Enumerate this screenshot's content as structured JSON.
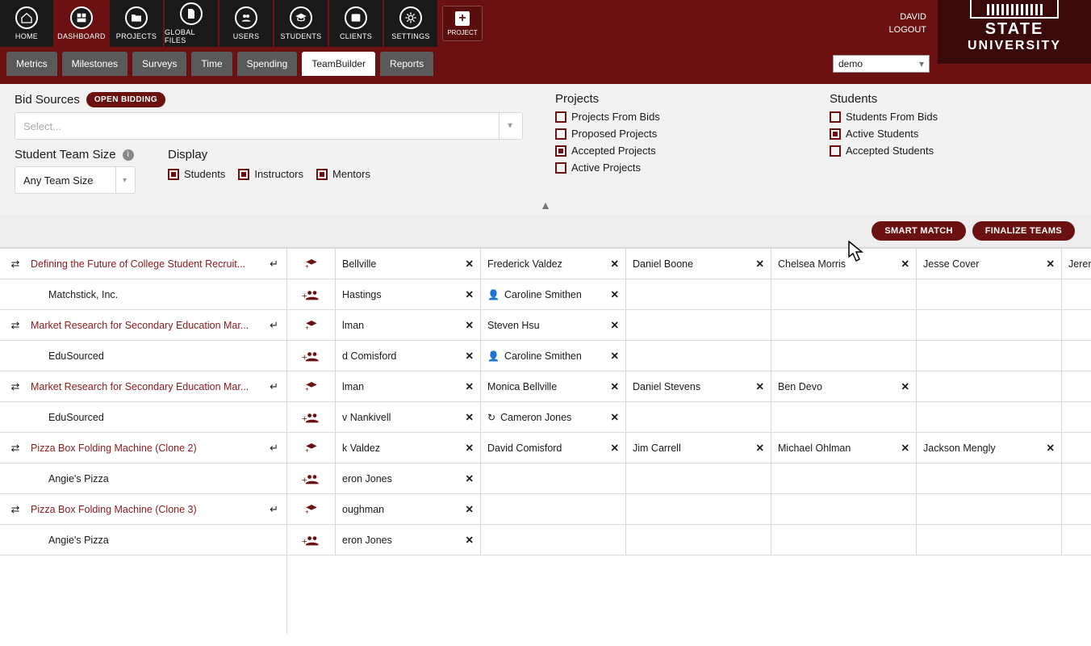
{
  "nav": [
    {
      "label": "HOME",
      "icon": "home",
      "active": false
    },
    {
      "label": "DASHBOARD",
      "icon": "dashboard",
      "active": true
    },
    {
      "label": "PROJECTS",
      "icon": "folder",
      "active": false
    },
    {
      "label": "GLOBAL FILES",
      "icon": "file",
      "active": false
    },
    {
      "label": "USERS",
      "icon": "users",
      "active": false
    },
    {
      "label": "STUDENTS",
      "icon": "grad",
      "active": false
    },
    {
      "label": "CLIENTS",
      "icon": "id",
      "active": false
    },
    {
      "label": "SETTINGS",
      "icon": "cog",
      "active": false
    }
  ],
  "projectBtn": {
    "plus": "+",
    "label": "PROJECT"
  },
  "user": {
    "name": "DAVID",
    "action": "LOGOUT"
  },
  "logo": {
    "line1": "STATE",
    "line2": "UNIVERSITY"
  },
  "tabs": [
    "Metrics",
    "Milestones",
    "Surveys",
    "Time",
    "Spending",
    "TeamBuilder",
    "Reports"
  ],
  "activeTab": "TeamBuilder",
  "orgSelect": "demo",
  "bidSources": {
    "title": "Bid Sources",
    "pill": "OPEN BIDDING",
    "placeholder": "Select..."
  },
  "teamSize": {
    "title": "Student Team Size",
    "value": "Any Team Size"
  },
  "display": {
    "title": "Display",
    "students": "Students",
    "instructors": "Instructors",
    "mentors": "Mentors"
  },
  "projects": {
    "title": "Projects",
    "fromBids": "Projects From Bids",
    "proposed": "Proposed Projects",
    "accepted": "Accepted Projects",
    "active": "Active Projects"
  },
  "students": {
    "title": "Students",
    "fromBids": "Students From Bids",
    "active": "Active Students",
    "accepted": "Accepted Students"
  },
  "actions": {
    "smart": "SMART MATCH",
    "finalize": "FINALIZE TEAMS"
  },
  "rows": [
    {
      "type": "proj",
      "name": "Defining the Future of College Student Recruit...",
      "arrow": true,
      "students": [
        {
          "n": "Bellville"
        },
        {
          "n": "Frederick Valdez"
        },
        {
          "n": "Daniel Boone"
        },
        {
          "n": "Chelsea Morris"
        },
        {
          "n": "Jesse Cover"
        },
        {
          "n": "Jeremey E"
        }
      ],
      "add": "grad"
    },
    {
      "type": "comp",
      "name": "Matchstick, Inc.",
      "students": [
        {
          "n": "Hastings"
        },
        {
          "n": "Caroline Smithen",
          "i": true
        },
        {
          "n": ""
        },
        {
          "n": ""
        },
        {
          "n": ""
        },
        {
          "n": ""
        }
      ],
      "add": "team"
    },
    {
      "type": "proj",
      "name": "Market Research for Secondary Education Mar...",
      "arrow": true,
      "students": [
        {
          "n": "lman"
        },
        {
          "n": "Steven Hsu"
        },
        {
          "n": ""
        },
        {
          "n": ""
        },
        {
          "n": ""
        },
        {
          "n": ""
        }
      ],
      "add": "grad"
    },
    {
      "type": "comp",
      "name": "EduSourced",
      "students": [
        {
          "n": "d Comisford"
        },
        {
          "n": "Caroline Smithen",
          "i": true
        },
        {
          "n": ""
        },
        {
          "n": ""
        },
        {
          "n": ""
        },
        {
          "n": ""
        }
      ],
      "add": "team"
    },
    {
      "type": "proj",
      "name": "Market Research for Secondary Education Mar...",
      "arrow": true,
      "students": [
        {
          "n": "lman"
        },
        {
          "n": "Monica Bellville"
        },
        {
          "n": "Daniel Stevens"
        },
        {
          "n": "Ben Devo"
        },
        {
          "n": ""
        },
        {
          "n": ""
        }
      ],
      "add": "grad"
    },
    {
      "type": "comp",
      "name": "EduSourced",
      "students": [
        {
          "n": "v Nankivell"
        },
        {
          "n": "Cameron Jones",
          "i2": true
        },
        {
          "n": ""
        },
        {
          "n": ""
        },
        {
          "n": ""
        },
        {
          "n": ""
        }
      ],
      "add": "team"
    },
    {
      "type": "proj",
      "name": "Pizza Box Folding Machine (Clone 2)",
      "arrow": true,
      "students": [
        {
          "n": "k Valdez"
        },
        {
          "n": "David Comisford"
        },
        {
          "n": "Jim Carrell"
        },
        {
          "n": "Michael Ohlman"
        },
        {
          "n": "Jackson Mengly"
        },
        {
          "n": ""
        }
      ],
      "add": "grad"
    },
    {
      "type": "comp",
      "name": "Angie's Pizza",
      "students": [
        {
          "n": "eron Jones"
        },
        {
          "n": ""
        },
        {
          "n": ""
        },
        {
          "n": ""
        },
        {
          "n": ""
        },
        {
          "n": ""
        }
      ],
      "add": "team"
    },
    {
      "type": "proj",
      "name": "Pizza Box Folding Machine (Clone 3)",
      "arrow": true,
      "students": [
        {
          "n": "oughman"
        },
        {
          "n": ""
        },
        {
          "n": ""
        },
        {
          "n": ""
        },
        {
          "n": ""
        },
        {
          "n": ""
        }
      ],
      "add": "grad"
    },
    {
      "type": "comp",
      "name": "Angie's Pizza",
      "students": [
        {
          "n": "eron Jones"
        },
        {
          "n": ""
        },
        {
          "n": ""
        },
        {
          "n": ""
        },
        {
          "n": ""
        },
        {
          "n": ""
        }
      ],
      "add": "team"
    }
  ]
}
